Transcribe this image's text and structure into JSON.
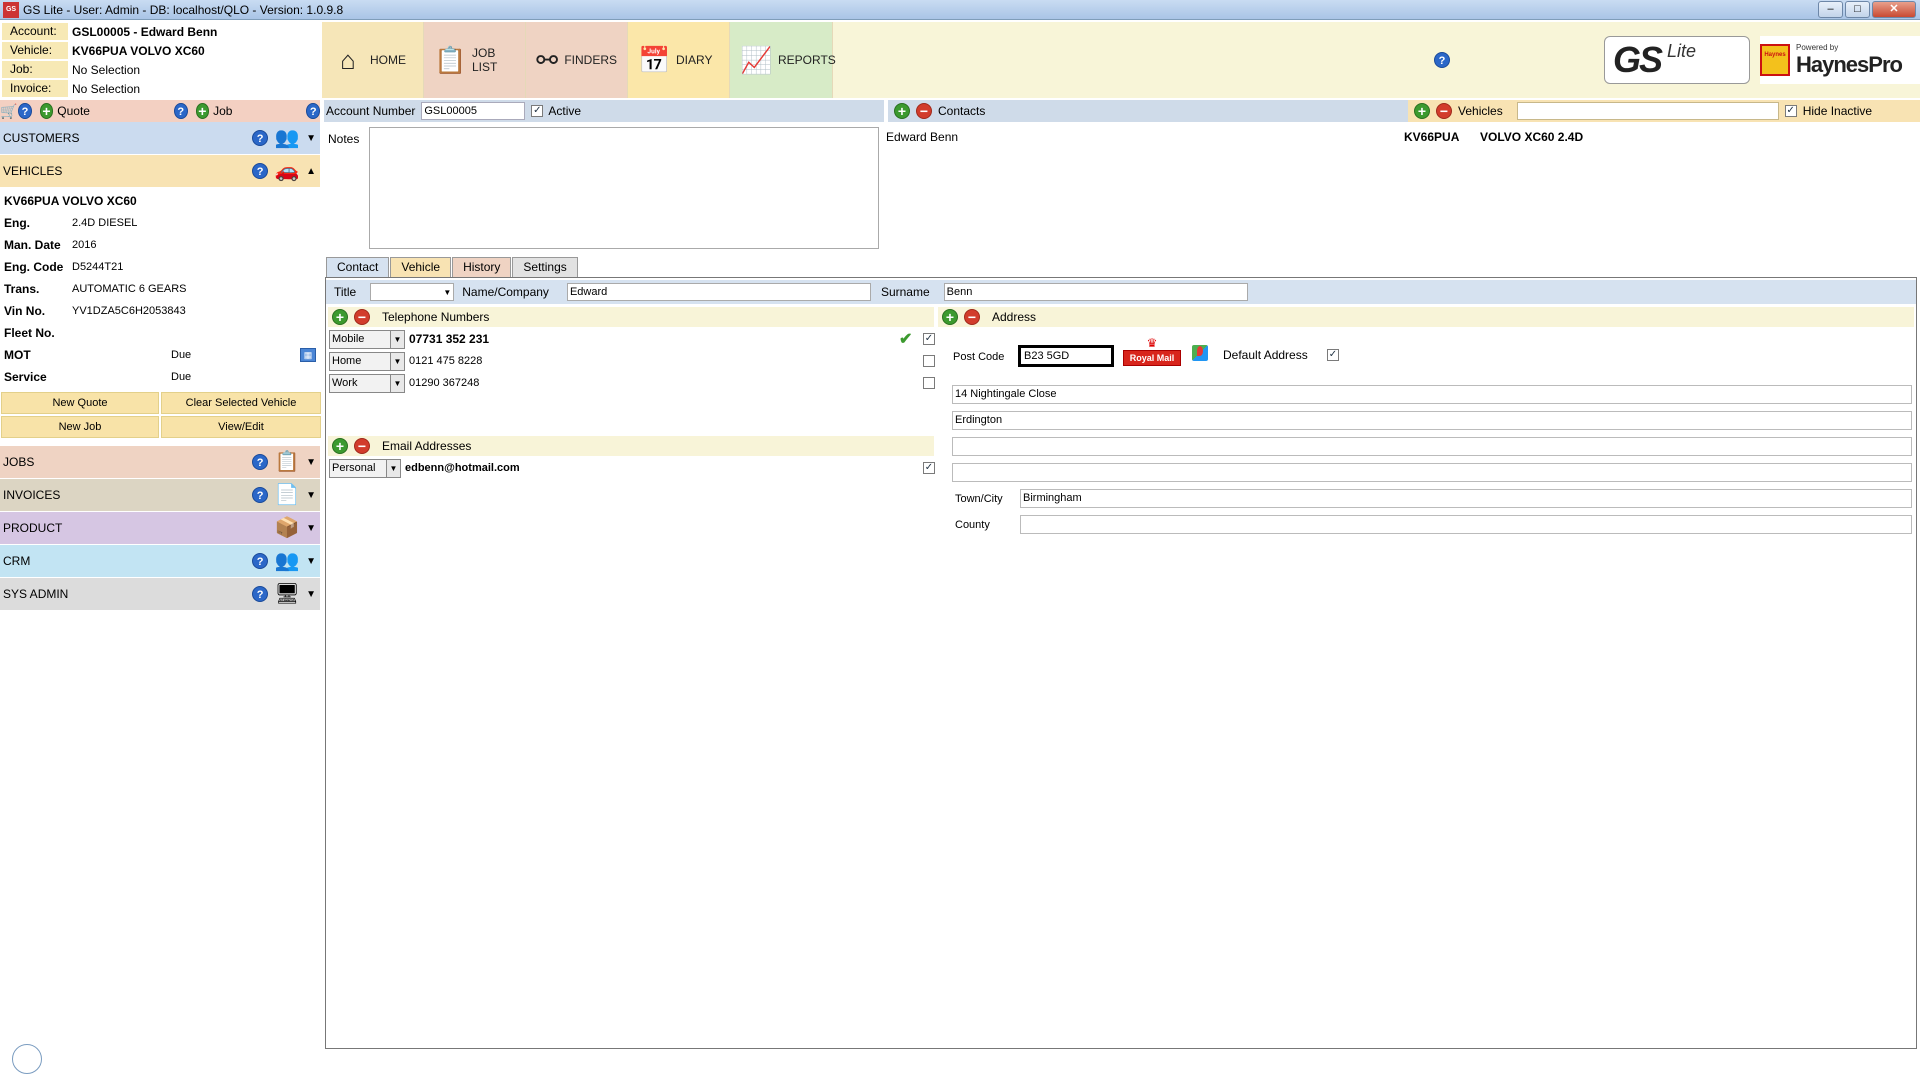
{
  "window": {
    "title": "GS Lite - User: Admin - DB: localhost/QLO - Version: 1.0.9.8",
    "app_icon_text": "GS",
    "controls": [
      "–",
      "□",
      "✕"
    ]
  },
  "info": {
    "account_label": "Account:",
    "account_value": "GSL00005 - Edward Benn",
    "vehicle_label": "Vehicle:",
    "vehicle_value": "KV66PUA VOLVO XC60",
    "job_label": "Job:",
    "job_value": "No Selection",
    "invoice_label": "Invoice:",
    "invoice_value": "No Selection"
  },
  "nav": {
    "home": "HOME",
    "job_list": "JOB LIST",
    "finders": "FINDERS",
    "diary": "DIARY",
    "reports": "REPORTS",
    "help": "?"
  },
  "logos": {
    "gs": "GS",
    "lite": "Lite",
    "haynes_badge": "Haynes",
    "haynes_powered": "Powered by",
    "haynes_name": "HaynesPro"
  },
  "sidebar": {
    "quote_label": "Quote",
    "job_label": "Job",
    "sections": {
      "customers": "CUSTOMERS",
      "vehicles": "VEHICLES",
      "jobs": "JOBS",
      "invoices": "INVOICES",
      "product": "PRODUCT",
      "crm": "CRM",
      "sys_admin": "SYS ADMIN"
    },
    "vehicle": {
      "title": "KV66PUA VOLVO XC60",
      "rows": [
        {
          "k": "Eng.",
          "v": "2.4D  DIESEL"
        },
        {
          "k": "Man. Date",
          "v": "2016"
        },
        {
          "k": "Eng. Code",
          "v": "D5244T21"
        },
        {
          "k": "Trans.",
          "v": "AUTOMATIC 6 GEARS"
        },
        {
          "k": "Vin No.",
          "v": "YV1DZA5C6H2053843"
        },
        {
          "k": "Fleet No.",
          "v": ""
        }
      ],
      "mot_label": "MOT",
      "mot_value": "Due",
      "service_label": "Service",
      "service_value": "Due",
      "buttons": {
        "new_quote": "New Quote",
        "clear_selected": "Clear Selected Vehicle",
        "new_job": "New Job",
        "view_edit": "View/Edit"
      }
    }
  },
  "account": {
    "number_label": "Account Number",
    "number_value": "GSL00005",
    "active_label": "Active",
    "active_checked": "✓",
    "notes_label": "Notes",
    "contacts_label": "Contacts",
    "contact_name": "Edward Benn",
    "vehicles_label": "Vehicles",
    "hide_inactive_label": "Hide Inactive",
    "vehicle_reg": "KV66PUA",
    "vehicle_model": "VOLVO XC60 2.4D"
  },
  "tabs": [
    "Contact",
    "Vehicle",
    "History",
    "Settings"
  ],
  "contact": {
    "title_label": "Title",
    "title_value": "",
    "name_label": "Name/Company",
    "name_value": "Edward",
    "surname_label": "Surname",
    "surname_value": "Benn",
    "telephone_label": "Telephone Numbers",
    "phones": [
      {
        "type": "Mobile",
        "number": "07731 352 231",
        "checked": "✓"
      },
      {
        "type": "Home",
        "number": "0121 475 8228",
        "checked": ""
      },
      {
        "type": "Work",
        "number": "01290 367248",
        "checked": ""
      }
    ],
    "email_label": "Email Addresses",
    "emails": [
      {
        "type": "Personal",
        "address": "edbenn@hotmail.com",
        "checked": "✓"
      }
    ],
    "address_label": "Address",
    "postcode_label": "Post Code",
    "postcode_value": "B23 5GD",
    "royal_mail": "Royal Mail",
    "default_address_label": "Default Address",
    "default_checked": "✓",
    "address_lines": [
      "14 Nightingale Close",
      "Erdington",
      "",
      ""
    ],
    "town_label": "Town/City",
    "town_value": "Birmingham",
    "county_label": "County",
    "county_value": ""
  }
}
